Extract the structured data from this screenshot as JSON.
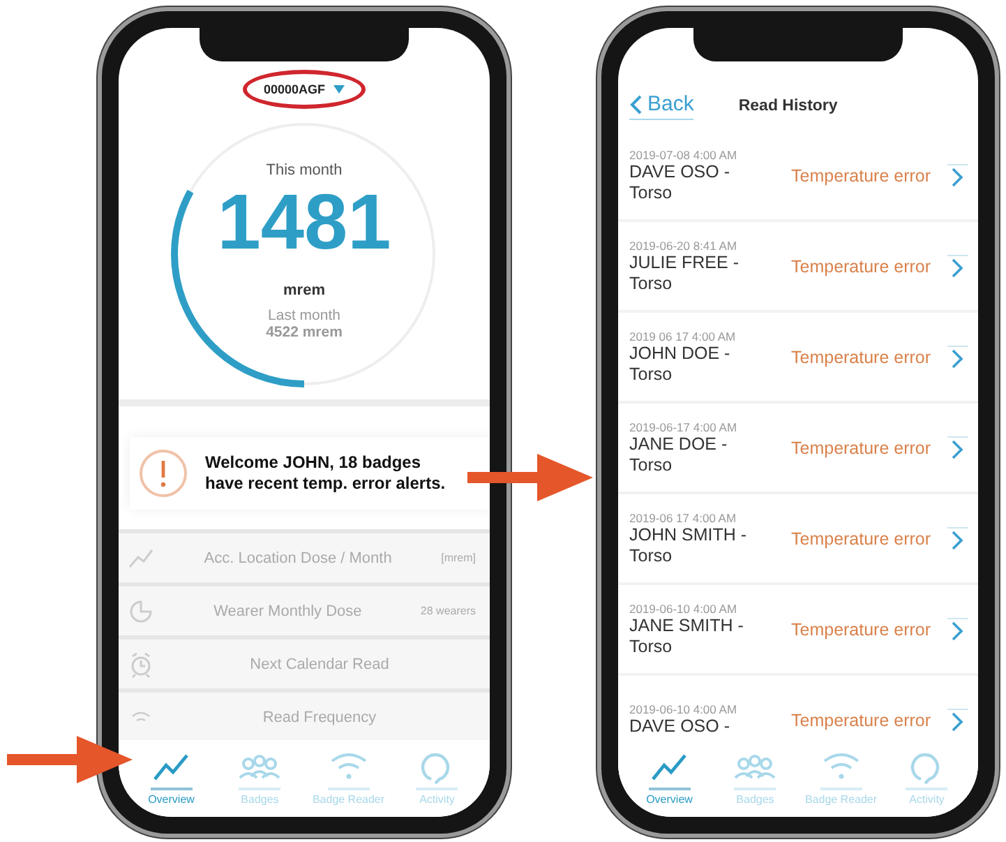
{
  "phones": [
    {
      "kind": "overview",
      "badge_selector": {
        "label": "00000AGF"
      },
      "dose": {
        "caption": "This month",
        "value": "1481",
        "unit": "mrem",
        "previous_label": "Last month",
        "previous_value": "4522 mrem",
        "level": 0.33
      },
      "alert": {
        "text": "Welcome JOHN, 18 badges have recent temp. error alerts."
      },
      "cards": [
        {
          "title": "Acc. Location Dose / Month",
          "detail": "[mrem]"
        },
        {
          "title": "Wearer Monthly Dose",
          "detail": "28 wearers"
        },
        {
          "title": "Next Calendar Read"
        },
        {
          "title": "Read Frequency"
        }
      ],
      "tabs": [
        {
          "label": "Overview",
          "selected": true
        },
        {
          "label": "Badges",
          "selected": false
        },
        {
          "label": "Badge Reader",
          "selected": false
        },
        {
          "label": "Activity",
          "selected": false
        }
      ]
    },
    {
      "kind": "history",
      "back": "Back",
      "title": "Read History",
      "rows": [
        {
          "timestamp": "2019-07-08 4:00 AM",
          "name": "DAVE OSO -",
          "location": "Torso",
          "status": "Temperature error"
        },
        {
          "timestamp": "2019-06-20 8:41 AM",
          "name": "JULIE FREE -",
          "location": "Torso",
          "status": "Temperature error"
        },
        {
          "timestamp": "2019 06 17 4:00 AM",
          "name": "JOHN DOE -",
          "location": "Torso",
          "status": "Temperature error"
        },
        {
          "timestamp": "2019-06-17 4:00 AM",
          "name": "JANE DOE -",
          "location": "Torso",
          "status": "Temperature error"
        },
        {
          "timestamp": "2019-06 17 4:00 AM",
          "name": "JOHN SMITH -",
          "location": "Torso",
          "status": "Temperature error"
        },
        {
          "timestamp": "2019-06-10 4:00 AM",
          "name": "JANE SMITH -",
          "location": "Torso",
          "status": "Temperature error"
        },
        {
          "timestamp": "2019-06-10 4:00 AM",
          "name": "DAVE OSO -",
          "status": "Temperature error"
        }
      ],
      "tabs": [
        {
          "label": "Overview",
          "selected": true
        },
        {
          "label": "Badges",
          "selected": false
        },
        {
          "label": "Badge Reader",
          "selected": false
        },
        {
          "label": "Activity",
          "selected": false
        }
      ]
    }
  ]
}
